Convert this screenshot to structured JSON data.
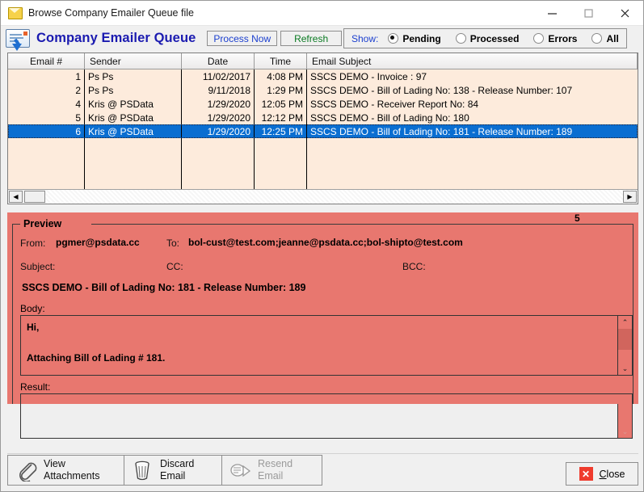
{
  "window": {
    "title": "Browse Company Emailer Queue file",
    "icon": "envelope-icon",
    "controls": {
      "minimize": "–",
      "maximize": "□",
      "close": "✕"
    }
  },
  "appbar": {
    "icon": "email-send-icon",
    "title": "Company Emailer Queue",
    "process_now": "Process Now",
    "refresh": "Refresh",
    "show_label": "Show:",
    "radios": [
      {
        "label": "Pending",
        "selected": true
      },
      {
        "label": "Processed",
        "selected": false
      },
      {
        "label": "Errors",
        "selected": false
      },
      {
        "label": "All",
        "selected": false
      }
    ]
  },
  "grid": {
    "columns": [
      "Email #",
      "Sender",
      "Date",
      "Time",
      "Email Subject"
    ],
    "rows": [
      {
        "num": "1",
        "sender": "Ps Ps",
        "date": "11/02/2017",
        "time": "4:08 PM",
        "subject": "SSCS DEMO - Invoice : 97",
        "selected": false
      },
      {
        "num": "2",
        "sender": "Ps Ps",
        "date": "9/11/2018",
        "time": "1:29 PM",
        "subject": "SSCS DEMO - Bill of Lading No: 138 - Release Number: 107",
        "selected": false
      },
      {
        "num": "4",
        "sender": "Kris @ PSData",
        "date": "1/29/2020",
        "time": "12:05 PM",
        "subject": "SSCS DEMO - Receiver Report No: 84",
        "selected": false
      },
      {
        "num": "5",
        "sender": "Kris @ PSData",
        "date": "1/29/2020",
        "time": "12:12 PM",
        "subject": "SSCS DEMO - Bill of Lading No: 180",
        "selected": false
      },
      {
        "num": "6",
        "sender": "Kris @ PSData",
        "date": "1/29/2020",
        "time": "12:25 PM",
        "subject": "SSCS DEMO - Bill of Lading No: 181 - Release Number: 189",
        "selected": true
      }
    ]
  },
  "preview": {
    "group_title": "Preview",
    "badge": "5",
    "from_label": "From:",
    "from_value": "pgmer@psdata.cc",
    "to_label": "To:",
    "to_value": "bol-cust@test.com;jeanne@psdata.cc;bol-shipto@test.com",
    "subject_label": "Subject:",
    "cc_label": "CC:",
    "cc_value": "",
    "bcc_label": "BCC:",
    "bcc_value": "",
    "subject_value": "SSCS DEMO - Bill of Lading No: 181 - Release Number: 189",
    "body_label": "Body:",
    "body_value": "Hi,\n\nAttaching Bill of Lading # 181.",
    "result_label": "Result:",
    "result_value": ""
  },
  "buttons": {
    "view_attachments_line1": "View",
    "view_attachments_line2": "Attachments",
    "discard_line1": "Discard",
    "discard_line2": "Email",
    "resend_line1": "Resend",
    "resend_line2": "Email",
    "close": "lose",
    "close_accel": "C"
  },
  "colors": {
    "preview_bg": "#e8776f",
    "grid_bg": "#fdebdc",
    "selection": "#0a6ed1",
    "app_title": "#1a1ab0",
    "process_now": "#1b3fcf",
    "refresh": "#0a7a22",
    "close_x": "#ef3b2d"
  }
}
